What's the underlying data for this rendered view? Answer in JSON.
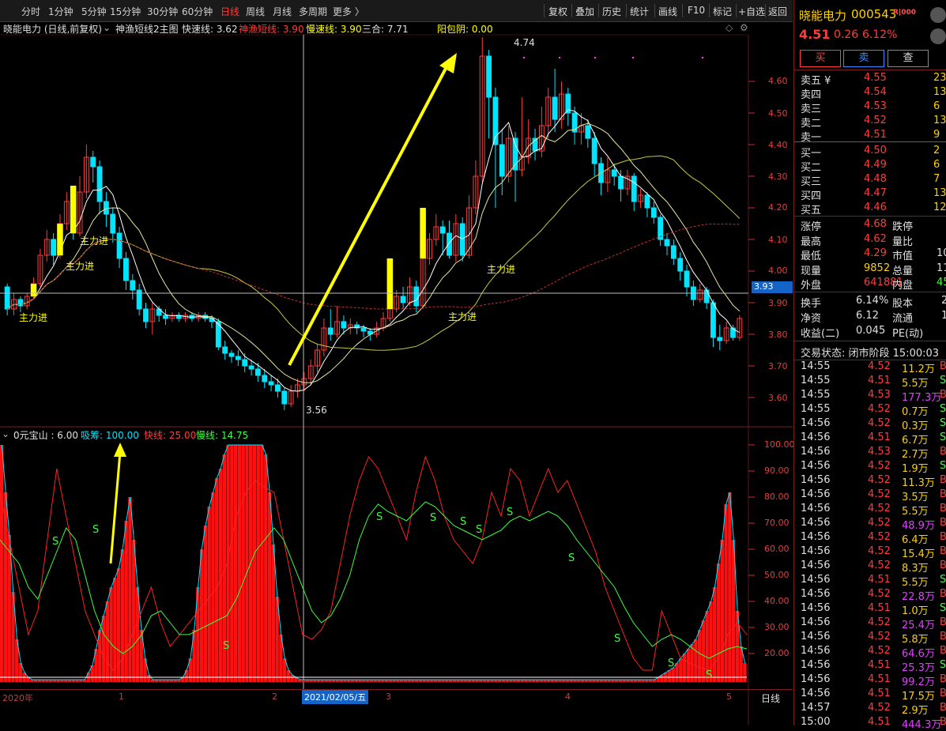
{
  "toolbar": {
    "periods": [
      "分时",
      "1分钟",
      "5分钟",
      "15分钟",
      "30分钟",
      "60分钟",
      "日线",
      "周线",
      "月线",
      "多周期",
      "更多 〉"
    ],
    "active_period": "日线",
    "tools": [
      "复权",
      "叠加",
      "历史",
      "统计",
      "画线",
      "F10",
      "标记",
      "+自选",
      "返回"
    ]
  },
  "main_info": {
    "stock": "晓能电力 (日线,前复权)",
    "indicator": "神渔短线2主图",
    "fast_label": "快速线: 3.62",
    "shenyu_label": "神渔短线: 3.90",
    "slow_label": "慢速线: 3.90",
    "sanhe_label": "三合: 7.71",
    "yangbao_label": "阳包阴: 0.00"
  },
  "main_annotations": {
    "high_label": "4.74",
    "low_label": "3.56",
    "zhuli": [
      "主力进",
      "主力进",
      "主力进",
      "主力进",
      "主力进"
    ],
    "cross_price": "3.93"
  },
  "price_axis": [
    "4.60",
    "4.50",
    "4.40",
    "4.30",
    "4.20",
    "4.10",
    "4.00",
    "3.90",
    "3.80",
    "3.70",
    "3.60"
  ],
  "sub_info": {
    "name": "0元宝山 : 6.00",
    "xichou": "吸筹: 100.00",
    "kuaixian": "快线: 25.00",
    "manxian": "慢线: 14.75"
  },
  "sub_axis": [
    "100.00",
    "90.00",
    "80.00",
    "70.00",
    "60.00",
    "50.00",
    "40.00",
    "30.00",
    "20.00"
  ],
  "s_marks": [
    "S",
    "S",
    "S",
    "S",
    "S",
    "S",
    "S",
    "S",
    "S",
    "S",
    "S",
    "S"
  ],
  "date_axis": {
    "labels": [
      "2020年",
      "1",
      "2",
      "3",
      "4",
      "5"
    ],
    "cursor_date": "2021/02/05/五",
    "period": "日线"
  },
  "colors": {
    "up": "#ff3c3c",
    "down": "#00e5ff",
    "yellow": "#ffff00",
    "green": "#3cff3c",
    "white": "#ffffff",
    "red_line": "#ff2020",
    "ma_dash": "#c03030",
    "bg": "#000000",
    "grid": "#5a1a1a"
  },
  "quote": {
    "name": "晓能电力",
    "code": "000543",
    "tag": "R|000",
    "price": "4.51",
    "change": "0.26",
    "pct": "6.12%",
    "buy_btn": "买",
    "sell_btn": "卖",
    "query_btn": "查"
  },
  "asks": [
    {
      "label": "卖五 ¥",
      "price": "4.55",
      "vol": "23"
    },
    {
      "label": "卖四",
      "price": "4.54",
      "vol": "13"
    },
    {
      "label": "卖三",
      "price": "4.53",
      "vol": "6"
    },
    {
      "label": "卖二",
      "price": "4.52",
      "vol": "13"
    },
    {
      "label": "卖一",
      "price": "4.51",
      "vol": "9"
    }
  ],
  "bids": [
    {
      "label": "买一",
      "price": "4.50",
      "vol": "2"
    },
    {
      "label": "买二",
      "price": "4.49",
      "vol": "6"
    },
    {
      "label": "买三",
      "price": "4.48",
      "vol": "7"
    },
    {
      "label": "买四",
      "price": "4.47",
      "vol": "13"
    },
    {
      "label": "买五",
      "price": "4.46",
      "vol": "12"
    }
  ],
  "stats": [
    {
      "k1": "涨停",
      "v1": "4.68",
      "k2": "跌停",
      "v2": ""
    },
    {
      "k1": "最高",
      "v1": "4.62",
      "k2": "量比",
      "v2": ""
    },
    {
      "k1": "最低",
      "v1": "4.29",
      "k2": "市值",
      "v2": "10"
    },
    {
      "k1": "现量",
      "v1": "9852",
      "k2": "总量",
      "v2": "11"
    },
    {
      "k1": "外盘",
      "v1": "641881",
      "k2": "内盘",
      "v2": "45"
    }
  ],
  "stats2": [
    {
      "k1": "换手",
      "v1": "6.14%",
      "k2": "股本",
      "v2": "2"
    },
    {
      "k1": "净资",
      "v1": "6.12",
      "k2": "流通",
      "v2": "1"
    },
    {
      "k1": "收益(二)",
      "v1": "0.045",
      "k2": "PE(动)",
      "v2": ""
    }
  ],
  "trade_status": "交易状态: 闭市阶段 15:00:03",
  "ticks": [
    {
      "t": "14:55",
      "p": "4.52",
      "v": "11.2万",
      "d": "B"
    },
    {
      "t": "14:55",
      "p": "4.51",
      "v": "5.5万",
      "d": "S"
    },
    {
      "t": "14:55",
      "p": "4.53",
      "v": "177.3万",
      "d": "B"
    },
    {
      "t": "14:55",
      "p": "4.52",
      "v": "0.7万",
      "d": "S"
    },
    {
      "t": "14:56",
      "p": "4.52",
      "v": "0.3万",
      "d": "S"
    },
    {
      "t": "14:56",
      "p": "4.51",
      "v": "6.7万",
      "d": "S"
    },
    {
      "t": "14:56",
      "p": "4.53",
      "v": "2.7万",
      "d": "B"
    },
    {
      "t": "14:56",
      "p": "4.52",
      "v": "1.9万",
      "d": "S"
    },
    {
      "t": "14:56",
      "p": "4.52",
      "v": "11.3万",
      "d": "B"
    },
    {
      "t": "14:56",
      "p": "4.52",
      "v": "3.5万",
      "d": "B"
    },
    {
      "t": "14:56",
      "p": "4.52",
      "v": "5.5万",
      "d": "B"
    },
    {
      "t": "14:56",
      "p": "4.52",
      "v": "48.9万",
      "d": "B"
    },
    {
      "t": "14:56",
      "p": "4.52",
      "v": "6.4万",
      "d": "B"
    },
    {
      "t": "14:56",
      "p": "4.52",
      "v": "15.4万",
      "d": "B"
    },
    {
      "t": "14:56",
      "p": "4.52",
      "v": "8.3万",
      "d": "B"
    },
    {
      "t": "14:56",
      "p": "4.51",
      "v": "5.5万",
      "d": "S"
    },
    {
      "t": "14:56",
      "p": "4.52",
      "v": "22.8万",
      "d": "B"
    },
    {
      "t": "14:56",
      "p": "4.51",
      "v": "1.0万",
      "d": "S"
    },
    {
      "t": "14:56",
      "p": "4.52",
      "v": "25.4万",
      "d": "B"
    },
    {
      "t": "14:56",
      "p": "4.52",
      "v": "5.8万",
      "d": "B"
    },
    {
      "t": "14:56",
      "p": "4.52",
      "v": "64.6万",
      "d": "B"
    },
    {
      "t": "14:56",
      "p": "4.51",
      "v": "25.3万",
      "d": "S"
    },
    {
      "t": "14:56",
      "p": "4.51",
      "v": "99.2万",
      "d": "B"
    },
    {
      "t": "14:56",
      "p": "4.51",
      "v": "17.5万",
      "d": "B"
    },
    {
      "t": "14:57",
      "p": "4.52",
      "v": "2.9万",
      "d": "B"
    },
    {
      "t": "15:00",
      "p": "4.51",
      "v": "444.3万",
      "d": "B"
    }
  ],
  "candles": [
    [
      3.95,
      3.88,
      3.96,
      3.86
    ],
    [
      3.88,
      3.91,
      3.93,
      3.86
    ],
    [
      3.91,
      3.89,
      3.92,
      3.87
    ],
    [
      3.89,
      3.92,
      3.93,
      3.88
    ],
    [
      3.92,
      3.96,
      3.98,
      3.91
    ],
    [
      3.96,
      4.05,
      4.07,
      3.95
    ],
    [
      4.05,
      4.1,
      4.13,
      4.03
    ],
    [
      4.1,
      4.05,
      4.12,
      4.02
    ],
    [
      4.05,
      4.15,
      4.18,
      4.04
    ],
    [
      4.15,
      4.22,
      4.25,
      4.13
    ],
    [
      4.22,
      4.12,
      4.26,
      4.1
    ],
    [
      4.12,
      4.25,
      4.3,
      4.11
    ],
    [
      4.25,
      4.36,
      4.4,
      4.23
    ],
    [
      4.36,
      4.33,
      4.38,
      4.28
    ],
    [
      4.33,
      4.22,
      4.35,
      4.18
    ],
    [
      4.22,
      4.18,
      4.25,
      4.14
    ],
    [
      4.18,
      4.12,
      4.2,
      4.09
    ],
    [
      4.12,
      4.04,
      4.14,
      4.01
    ],
    [
      4.04,
      3.97,
      4.06,
      3.94
    ],
    [
      3.97,
      3.94,
      3.99,
      3.91
    ],
    [
      3.94,
      3.88,
      3.96,
      3.86
    ],
    [
      3.88,
      3.84,
      3.9,
      3.82
    ],
    [
      3.84,
      3.88,
      3.9,
      3.8
    ],
    [
      3.88,
      3.86,
      3.89,
      3.84
    ],
    [
      3.86,
      3.85,
      3.88,
      3.83
    ],
    [
      3.85,
      3.86,
      3.87,
      3.84
    ],
    [
      3.86,
      3.85,
      3.87,
      3.84
    ],
    [
      3.85,
      3.86,
      3.87,
      3.84
    ],
    [
      3.86,
      3.85,
      3.87,
      3.84
    ],
    [
      3.85,
      3.86,
      3.87,
      3.84
    ],
    [
      3.86,
      3.85,
      3.87,
      3.84
    ],
    [
      3.85,
      3.84,
      3.86,
      3.82
    ],
    [
      3.84,
      3.76,
      3.85,
      3.75
    ],
    [
      3.76,
      3.74,
      3.78,
      3.72
    ],
    [
      3.74,
      3.73,
      3.75,
      3.71
    ],
    [
      3.73,
      3.72,
      3.75,
      3.7
    ],
    [
      3.72,
      3.7,
      3.74,
      3.68
    ],
    [
      3.7,
      3.69,
      3.72,
      3.67
    ],
    [
      3.69,
      3.67,
      3.71,
      3.65
    ],
    [
      3.67,
      3.65,
      3.69,
      3.63
    ],
    [
      3.65,
      3.64,
      3.67,
      3.62
    ],
    [
      3.64,
      3.62,
      3.66,
      3.6
    ],
    [
      3.62,
      3.58,
      3.63,
      3.56
    ],
    [
      3.58,
      3.62,
      3.64,
      3.57
    ],
    [
      3.62,
      3.64,
      3.66,
      3.6
    ],
    [
      3.64,
      3.66,
      3.68,
      3.62
    ],
    [
      3.66,
      3.7,
      3.72,
      3.64
    ],
    [
      3.7,
      3.75,
      3.77,
      3.68
    ],
    [
      3.75,
      3.82,
      3.85,
      3.73
    ],
    [
      3.82,
      3.8,
      3.88,
      3.78
    ],
    [
      3.8,
      3.84,
      3.89,
      3.79
    ],
    [
      3.84,
      3.82,
      3.86,
      3.8
    ],
    [
      3.82,
      3.83,
      3.85,
      3.8
    ],
    [
      3.83,
      3.82,
      3.84,
      3.8
    ],
    [
      3.82,
      3.81,
      3.83,
      3.79
    ],
    [
      3.81,
      3.8,
      3.82,
      3.78
    ],
    [
      3.8,
      3.82,
      3.84,
      3.79
    ],
    [
      3.82,
      3.85,
      3.87,
      3.81
    ],
    [
      3.85,
      3.88,
      3.9,
      3.84
    ],
    [
      3.88,
      3.92,
      3.94,
      3.87
    ],
    [
      3.92,
      3.9,
      3.95,
      3.88
    ],
    [
      3.9,
      3.95,
      3.98,
      3.89
    ],
    [
      3.95,
      3.89,
      3.97,
      3.87
    ],
    [
      3.89,
      4.04,
      4.06,
      3.88
    ],
    [
      4.04,
      4.1,
      4.12,
      4.02
    ],
    [
      4.1,
      4.14,
      4.18,
      4.08
    ],
    [
      4.14,
      4.12,
      4.16,
      4.05
    ],
    [
      4.12,
      4.05,
      4.16,
      4.04
    ],
    [
      4.05,
      4.15,
      4.18,
      4.03
    ],
    [
      4.15,
      4.05,
      4.17,
      4.03
    ],
    [
      4.05,
      4.2,
      4.24,
      4.04
    ],
    [
      4.2,
      4.3,
      4.35,
      4.18
    ],
    [
      4.3,
      4.68,
      4.74,
      4.28
    ],
    [
      4.68,
      4.55,
      4.7,
      4.42
    ],
    [
      4.55,
      4.4,
      4.58,
      4.2
    ],
    [
      4.4,
      4.3,
      4.45,
      4.24
    ],
    [
      4.3,
      4.42,
      4.46,
      4.28
    ],
    [
      4.42,
      4.32,
      4.44,
      4.22
    ],
    [
      4.32,
      4.36,
      4.55,
      4.3
    ],
    [
      4.36,
      4.42,
      4.48,
      4.34
    ],
    [
      4.42,
      4.38,
      4.45,
      4.35
    ],
    [
      4.38,
      4.46,
      4.52,
      4.36
    ],
    [
      4.46,
      4.55,
      4.58,
      4.42
    ],
    [
      4.55,
      4.48,
      4.64,
      4.44
    ],
    [
      4.48,
      4.56,
      4.6,
      4.45
    ],
    [
      4.56,
      4.5,
      4.58,
      4.46
    ],
    [
      4.5,
      4.44,
      4.52,
      4.4
    ],
    [
      4.44,
      4.46,
      4.5,
      4.4
    ],
    [
      4.46,
      4.42,
      4.48,
      4.39
    ],
    [
      4.42,
      4.34,
      4.44,
      4.3
    ],
    [
      4.34,
      4.28,
      4.36,
      4.24
    ],
    [
      4.28,
      4.32,
      4.36,
      4.25
    ],
    [
      4.32,
      4.3,
      4.34,
      4.27
    ],
    [
      4.3,
      4.26,
      4.32,
      4.22
    ],
    [
      4.26,
      4.3,
      4.32,
      4.24
    ],
    [
      4.3,
      4.22,
      4.31,
      4.19
    ],
    [
      4.22,
      4.24,
      4.26,
      4.2
    ],
    [
      4.24,
      4.2,
      4.25,
      4.17
    ],
    [
      4.2,
      4.17,
      4.22,
      4.15
    ],
    [
      4.17,
      4.1,
      4.18,
      4.08
    ],
    [
      4.1,
      4.08,
      4.12,
      4.05
    ],
    [
      4.08,
      4.04,
      4.1,
      4.02
    ],
    [
      4.04,
      4.0,
      4.06,
      3.97
    ],
    [
      4.0,
      3.95,
      4.02,
      3.92
    ],
    [
      3.95,
      3.91,
      3.97,
      3.89
    ],
    [
      3.91,
      3.94,
      3.96,
      3.9
    ],
    [
      3.94,
      3.9,
      3.95,
      3.88
    ],
    [
      3.9,
      3.79,
      3.91,
      3.76
    ],
    [
      3.79,
      3.78,
      3.83,
      3.75
    ],
    [
      3.78,
      3.82,
      3.84,
      3.77
    ],
    [
      3.82,
      3.79,
      3.83,
      3.78
    ],
    [
      3.79,
      3.85,
      3.86,
      3.78
    ]
  ],
  "sub_bars": [
    100,
    80,
    62,
    38,
    18,
    8,
    4,
    2,
    1,
    1,
    1,
    1,
    1,
    1,
    1,
    1,
    1,
    1,
    1,
    1,
    1,
    1,
    1,
    4,
    7,
    14,
    22,
    28,
    34,
    40,
    44,
    48,
    56,
    68,
    78,
    60,
    40,
    22,
    10,
    3,
    1,
    1,
    1,
    1,
    1,
    1,
    1,
    1,
    2,
    5,
    10,
    22,
    40,
    56,
    66,
    74,
    80,
    86,
    90,
    96,
    100,
    100,
    100,
    100,
    100,
    100,
    100,
    100,
    100,
    100,
    96,
    80,
    58,
    36,
    20,
    10,
    5,
    3,
    2,
    1,
    1,
    1,
    1,
    1,
    1,
    1,
    1,
    1,
    1,
    1,
    1,
    1,
    1,
    1,
    1,
    1,
    1,
    1,
    1,
    1,
    1,
    1,
    1,
    1,
    1,
    1,
    1,
    1,
    1,
    1,
    1,
    1,
    1,
    1,
    1,
    1,
    1,
    1,
    1,
    1,
    1,
    1,
    1,
    1,
    1,
    1,
    1,
    1,
    1,
    1,
    1,
    1,
    1,
    1,
    1,
    1,
    1,
    1,
    1,
    1,
    1,
    1,
    1,
    1,
    1,
    1,
    1,
    1,
    1,
    1,
    1,
    1,
    1,
    1,
    1,
    1,
    1,
    1,
    1,
    1,
    1,
    1,
    1,
    1,
    1,
    1,
    1,
    1,
    1,
    1,
    1,
    1,
    1,
    1,
    2,
    3,
    4,
    5,
    6,
    8,
    10,
    12,
    14,
    16,
    18,
    22,
    26,
    30,
    34,
    40,
    50,
    60,
    75,
    80,
    60,
    30,
    15,
    8
  ]
}
